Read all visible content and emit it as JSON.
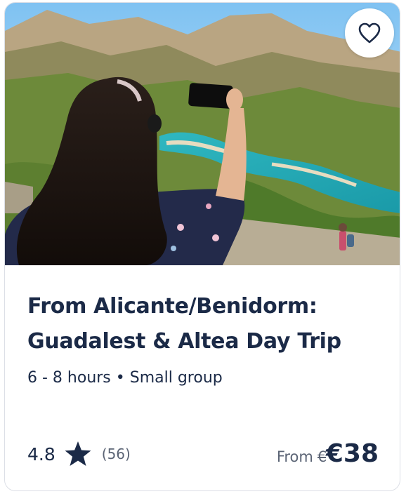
{
  "card": {
    "title_line1": "From Alicante/Benidorm:",
    "title_line2": "Guadalest & Altea Day Trip",
    "duration": "6 - 8 hours",
    "separator": "•",
    "group": "Small group",
    "rating": "4.8",
    "review_count": "(56)",
    "price_prefix": "From",
    "old_price": "€",
    "price": "€38",
    "image_alt": "Woman photographing Guadalest reservoir and mountains",
    "favorite_icon": "heart-outline-icon",
    "rating_icon": "star-icon"
  },
  "colors": {
    "text_primary": "#1b2a47",
    "text_secondary": "#5b6475",
    "border": "#dcdfe6"
  }
}
